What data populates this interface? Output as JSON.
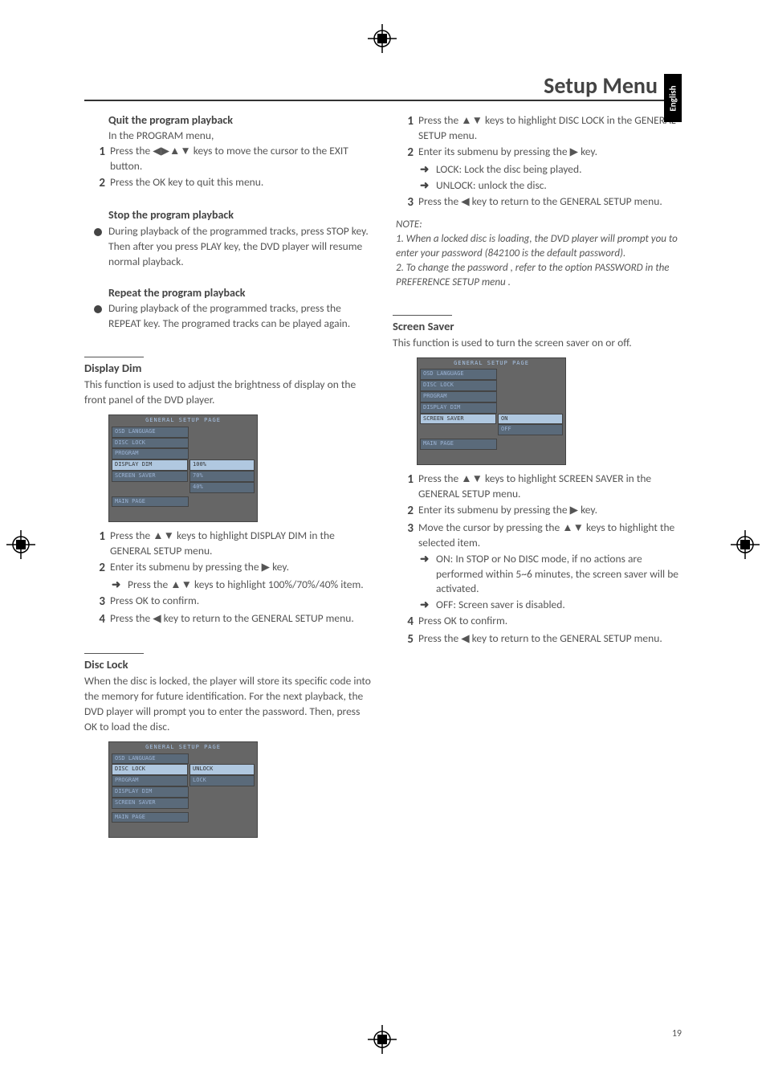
{
  "header": {
    "title": "Setup Menu",
    "language_tab": "English"
  },
  "page_number": "19",
  "left": {
    "quit": {
      "title": "Quit the program playback",
      "intro": "In the PROGRAM menu,",
      "s1": "Press the ◀▶▲▼ keys to move the cursor to the EXIT button.",
      "s2": "Press the OK key to quit this menu."
    },
    "stop": {
      "title": "Stop the program playback",
      "b1": "During playback of the programmed tracks, press STOP key. Then after you press PLAY key, the DVD player will resume normal playback."
    },
    "repeat": {
      "title": "Repeat the program playback",
      "b1": "During playback of the programmed tracks, press the REPEAT key. The programed tracks can be played again."
    },
    "display_dim": {
      "sect_title": "Display Dim",
      "desc": "This function is used to adjust the brightness of display on the front panel of the DVD player.",
      "ss_title": "GENERAL SETUP PAGE",
      "ss_rows": [
        "OSD LANGUAGE",
        "DISC LOCK",
        "PROGRAM",
        "DISPLAY DIM",
        "SCREEN SAVER"
      ],
      "ss_opts": [
        "100%",
        "70%",
        "40%"
      ],
      "ss_main": "MAIN PAGE",
      "s1": "Press the ▲▼ keys to highlight  DISPLAY DIM in the GENERAL SETUP menu.",
      "s2": "Enter its submenu by pressing the ▶  key.",
      "a2": "Press the ▲▼ keys to highlight 100%/70%/40% item.",
      "s3": "Press OK to confirm.",
      "s4": "Press the ◀ key to return to the GENERAL SETUP menu."
    },
    "disc_lock": {
      "sect_title": "Disc Lock",
      "desc": "When the disc is locked, the player will store its specific code into the memory for future identification. For the next playback, the DVD player will prompt you to enter the password. Then, press OK to load the disc.",
      "ss_title": "GENERAL SETUP PAGE",
      "ss_rows": [
        "OSD LANGUAGE",
        "DISC LOCK",
        "PROGRAM",
        "DISPLAY DIM",
        "SCREEN SAVER"
      ],
      "ss_opts": [
        "UNLOCK",
        "LOCK"
      ],
      "ss_main": "MAIN PAGE"
    }
  },
  "right": {
    "disc_lock_steps": {
      "s1": "Press the ▲▼ keys to highlight DISC LOCK in the GENERAL SETUP menu.",
      "s2": "Enter its submenu by pressing the ▶  key.",
      "a2a": "LOCK: Lock the disc being played.",
      "a2b": "UNLOCK: unlock the disc.",
      "s3": "Press the ◀ key to return to the GENERAL SETUP menu."
    },
    "note": {
      "label": "NOTE:",
      "l1": "1. When a locked disc is loading, the DVD player will prompt you to enter your password (842100 is the default password).",
      "l2": "2. To change the password , refer to the option PASSWORD in the PREFERENCE SETUP menu ."
    },
    "screen_saver": {
      "sect_title": "Screen Saver",
      "desc": "This function is used to turn the screen saver on or off.",
      "ss_title": "GENERAL SETUP PAGE",
      "ss_rows": [
        "OSD LANGUAGE",
        "DISC LOCK",
        "PROGRAM",
        "DISPLAY DIM",
        "SCREEN SAVER"
      ],
      "ss_opts": [
        "ON",
        "OFF"
      ],
      "ss_main": "MAIN PAGE",
      "s1": "Press the ▲▼ keys to highlight SCREEN SAVER in the GENERAL SETUP menu.",
      "s2": "Enter its submenu by pressing the ▶ key.",
      "s3": "Move the cursor by pressing the ▲▼ keys to highlight the selected item.",
      "a3a": "ON: In STOP or No DISC mode, if no actions are performed within 5~6 minutes, the screen saver will be activated.",
      "a3b": "OFF: Screen saver is disabled.",
      "s4": "Press OK to confirm.",
      "s5": "Press the ◀ key to return to the GENERAL SETUP menu."
    }
  }
}
